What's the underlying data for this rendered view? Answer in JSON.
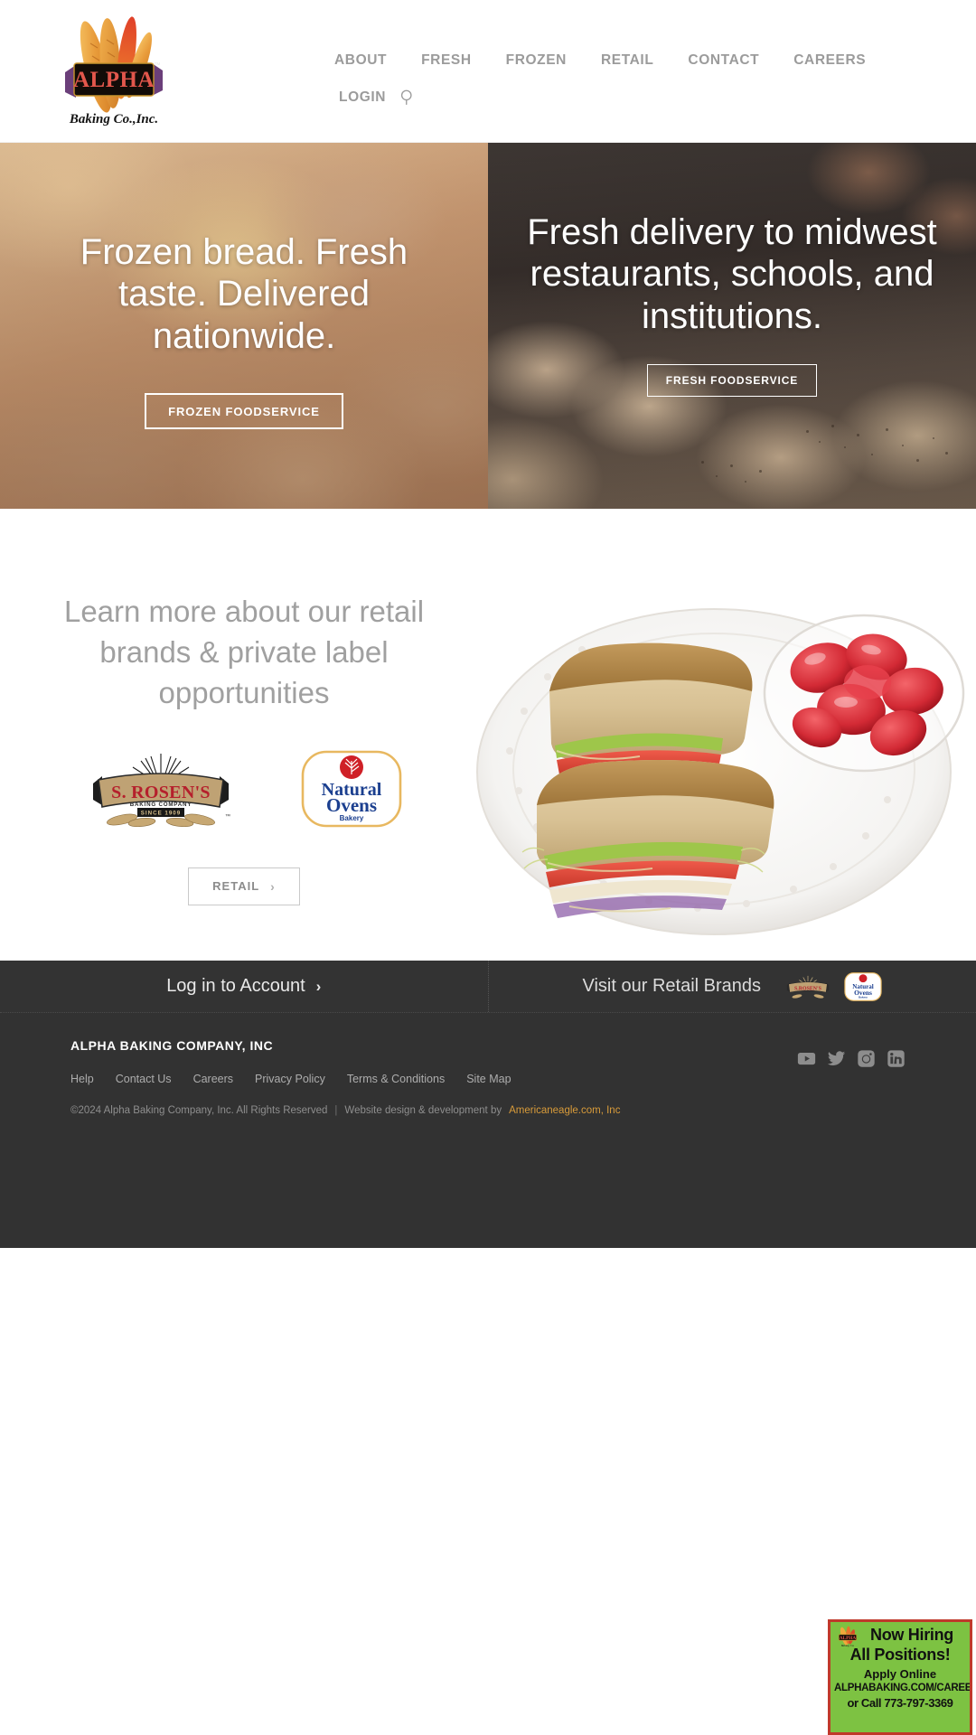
{
  "header": {
    "logo": {
      "brand": "ALPHA",
      "tagline": "Baking Co.,Inc.",
      "trademark": "™"
    },
    "nav_primary": [
      {
        "label": "ABOUT"
      },
      {
        "label": "FRESH"
      },
      {
        "label": "FROZEN"
      },
      {
        "label": "RETAIL"
      },
      {
        "label": "CONTACT"
      },
      {
        "label": "CAREERS"
      }
    ],
    "nav_secondary": [
      {
        "label": "LOGIN"
      }
    ],
    "search_icon": "search-icon"
  },
  "hero": {
    "left": {
      "title": "Frozen bread. Fresh taste. Delivered nationwide.",
      "button_label": "FROZEN FOODSERVICE"
    },
    "right": {
      "title": "Fresh delivery to midwest restaurants, schools, and institutions.",
      "button_label": "FRESH FOODSERVICE"
    }
  },
  "retail": {
    "heading": "Learn more about our retail brands & private label opportunities",
    "brands": [
      {
        "name": "S. ROSEN'S",
        "line2": "BAKING COMPANY",
        "line3": "SINCE 1909",
        "trademark": "™"
      },
      {
        "name": "Natural",
        "line2": "Ovens",
        "line3": "Bakery"
      }
    ],
    "button_label": "RETAIL",
    "button_chevron": "›"
  },
  "account_bar": {
    "login_label": "Log in to Account",
    "login_chevron": "›",
    "brands_label": "Visit our Retail Brands"
  },
  "footer": {
    "company": "ALPHA BAKING COMPANY, INC",
    "links": [
      {
        "label": "Help"
      },
      {
        "label": "Contact Us"
      },
      {
        "label": "Careers"
      },
      {
        "label": "Privacy Policy"
      },
      {
        "label": "Terms & Conditions"
      },
      {
        "label": "Site Map"
      }
    ],
    "copyright": "©2024 Alpha Baking Company, Inc. All Rights Reserved",
    "separator": "|",
    "credit_prefix": "Website design & development by",
    "credit_link": "Americaneagle.com, Inc",
    "social": [
      {
        "name": "youtube-icon"
      },
      {
        "name": "twitter-icon"
      },
      {
        "name": "instagram-icon"
      },
      {
        "name": "linkedin-icon"
      }
    ]
  },
  "hiring_badge": {
    "line1": "Now Hiring",
    "line2": "All Positions!",
    "line3": "Apply Online",
    "line4": "ALPHABAKING.COM/CAREERS",
    "line5": "or Call 773-797-3369"
  },
  "colors": {
    "accent_orange": "#d89b3a",
    "footer_bg": "#323232",
    "account_bar_bg": "#333333",
    "nav_text": "#9b9b9b",
    "badge_green": "#7dc242",
    "badge_border": "#c0392b"
  }
}
